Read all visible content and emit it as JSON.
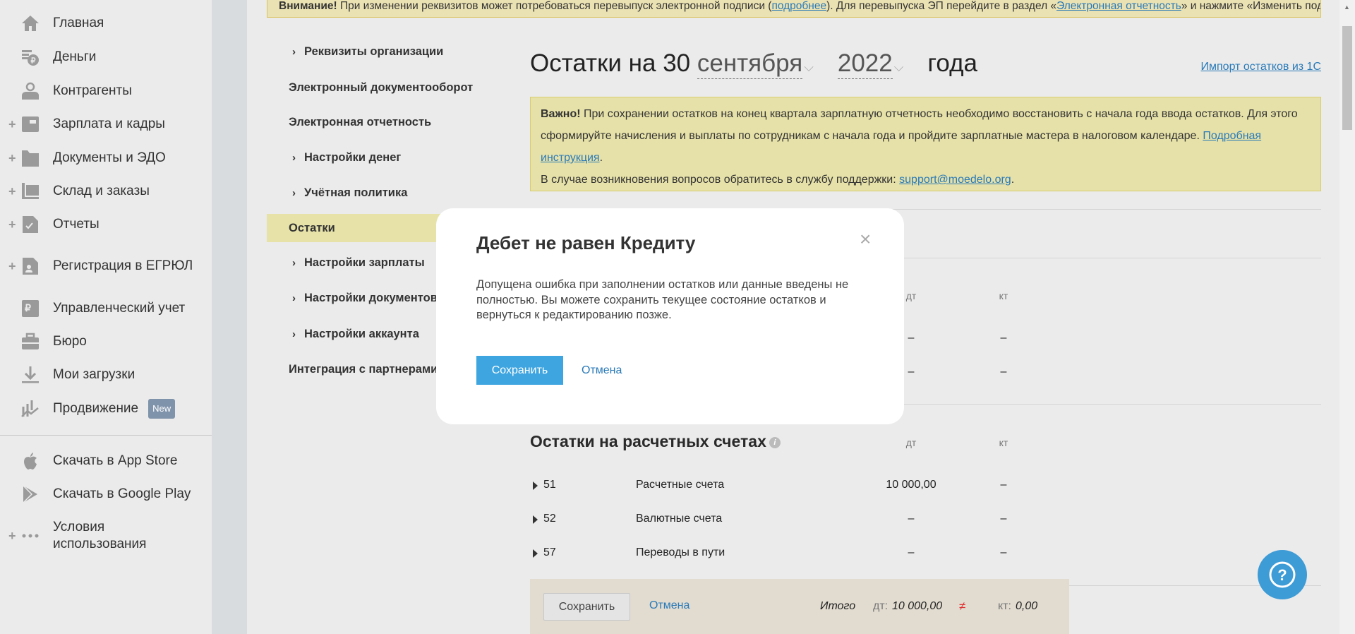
{
  "banner": {
    "bold": "Внимание!",
    "text1": " При изменении реквизитов может потребоваться перевыпуск электронной подписи (",
    "link1": "подробнее",
    "text2": "). Для перевыпуска ЭП перейдите в раздел «",
    "link2": "Электронная отчетность",
    "text3": "» и нажмите «Изменить подпись»"
  },
  "sidebar": {
    "items": [
      {
        "label": "Главная",
        "icon": "home-icon"
      },
      {
        "label": "Деньги",
        "icon": "money-icon"
      },
      {
        "label": "Контрагенты",
        "icon": "contractor-icon"
      },
      {
        "label": "Зарплата и кадры",
        "icon": "wallet-icon"
      },
      {
        "label": "Документы и ЭДО",
        "icon": "folder-icon"
      },
      {
        "label": "Склад и заказы",
        "icon": "warehouse-icon"
      },
      {
        "label": "Отчеты",
        "icon": "report-icon"
      },
      {
        "label": "Регистрация в ЕГРЮЛ",
        "icon": "registration-icon"
      },
      {
        "label": "Управленческий учет",
        "icon": "ruble-doc-icon"
      },
      {
        "label": "Бюро",
        "icon": "briefcase-icon"
      },
      {
        "label": "Мои загрузки",
        "icon": "download-icon"
      },
      {
        "label": "Продвижение",
        "icon": "chart-icon",
        "badge": "New"
      }
    ],
    "bottom": [
      {
        "label": "Скачать в App Store",
        "icon": "apple-icon"
      },
      {
        "label": "Скачать в Google Play",
        "icon": "google-play-icon"
      },
      {
        "label": "Условия использования",
        "icon": "more-icon"
      }
    ]
  },
  "nav": [
    {
      "label": "Реквизиты организации"
    },
    {
      "label": "Электронный документооборот"
    },
    {
      "label": "Электронная отчетность"
    },
    {
      "label": "Настройки денег"
    },
    {
      "label": "Учётная политика"
    },
    {
      "label": "Остатки"
    },
    {
      "label": "Настройки зарплаты"
    },
    {
      "label": "Настройки документов"
    },
    {
      "label": "Настройки аккаунта"
    },
    {
      "label": "Интеграция с партнерами"
    }
  ],
  "header": {
    "prefix": "Остатки на 30",
    "month": "сентября",
    "year": "2022",
    "suffix": "года",
    "import_link": "Импорт остатков из 1С"
  },
  "notice": {
    "bold": "Важно!",
    "text1": " При сохранении остатков на конец квартала зарплатную отчетность необходимо восстановить с начала года ввода остатков. Для этого сформируйте начисления и выплаты по сотрудникам с начала года и пройдите зарплатные мастера в налоговом календаре. ",
    "link1": "Подробная инструкция",
    "text2": ".",
    "text3": "В случае возникновения вопросов обратитесь в службу поддержки: ",
    "email": "support@moedelo.org",
    "text4": "."
  },
  "hidden_table": {
    "col_dt": "дт",
    "col_kt": "кт",
    "rows": [
      {
        "dt": "–",
        "kt": "–"
      },
      {
        "dt": "–",
        "kt": "–"
      }
    ]
  },
  "accounts": {
    "title": "Остатки на расчетных счетах",
    "info": "i",
    "col_dt": "дт",
    "col_kt": "кт",
    "rows": [
      {
        "num": "51",
        "name": "Расчетные счета",
        "dt": "10 000,00",
        "kt": "–"
      },
      {
        "num": "52",
        "name": "Валютные счета",
        "dt": "–",
        "kt": "–"
      },
      {
        "num": "57",
        "name": "Переводы в пути",
        "dt": "–",
        "kt": "–"
      }
    ]
  },
  "footer": {
    "save": "Сохранить",
    "cancel": "Отмена",
    "total_label": "Итого",
    "dt_label": "дт:",
    "dt_value": "10 000,00",
    "neq": "≠",
    "kt_label": "кт:",
    "kt_value": "0,00"
  },
  "modal": {
    "title": "Дебет не равен Кредиту",
    "close": "×",
    "body": "Допущена ошибка при заполнении остатков или данные введены не полностью. Вы можете сохранить текущее состояние остатков и вернуться к редактированию позже.",
    "save": "Сохранить",
    "cancel": "Отмена"
  },
  "help": {
    "label": "?"
  },
  "colors": {
    "accent": "#3ea5e0",
    "notice": "#e6e1a8",
    "selected": "#e6e2a8",
    "error": "#e03030"
  }
}
